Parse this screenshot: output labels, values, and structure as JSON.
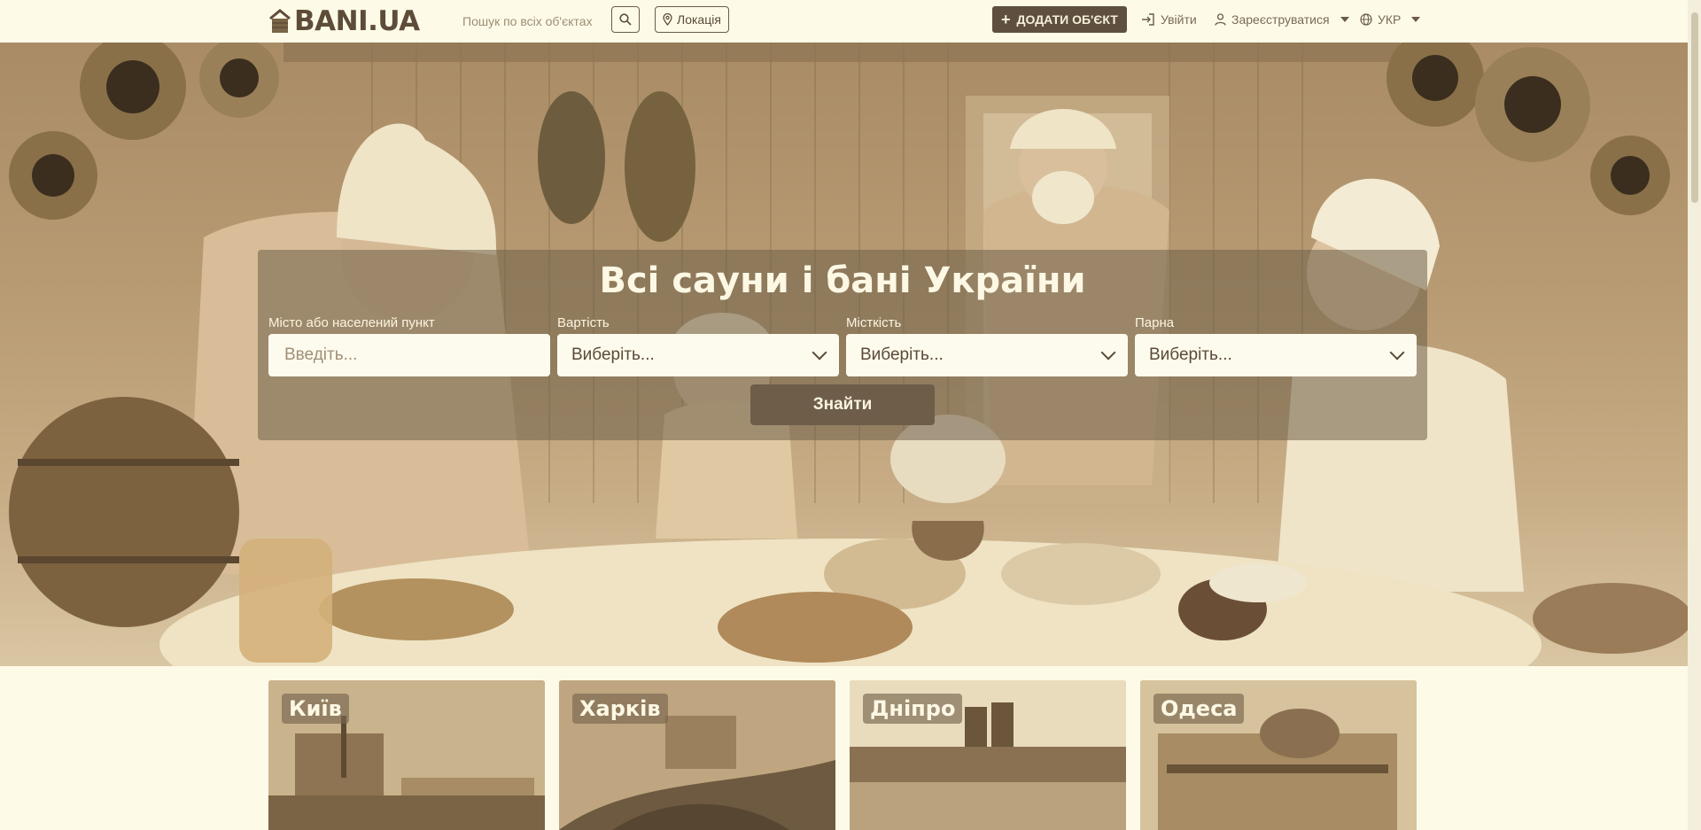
{
  "header": {
    "logo_text": "BANI.UA",
    "search_placeholder": "Пошук по всіх об'єктах",
    "location_label": "Локація",
    "add_label": "ДОДАТИ ОБ'ЄКТ",
    "login_label": "Увійти",
    "register_label": "Зареєструватися",
    "lang_label": "УКР"
  },
  "search": {
    "title": "Всі сауни і бані України",
    "city_label": "Місто або населений пункт",
    "city_placeholder": "Введіть...",
    "price_label": "Вартість",
    "price_value": "Виберіть...",
    "capacity_label": "Місткість",
    "capacity_value": "Виберіть...",
    "steam_label": "Парна",
    "steam_value": "Виберіть...",
    "submit_label": "Знайти"
  },
  "cities": [
    {
      "name": "Київ"
    },
    {
      "name": "Харків"
    },
    {
      "name": "Дніпро"
    },
    {
      "name": "Одеса"
    }
  ],
  "colors": {
    "background": "#fdfbe8",
    "primary": "#5e4f3e",
    "text": "#5a4a36"
  }
}
